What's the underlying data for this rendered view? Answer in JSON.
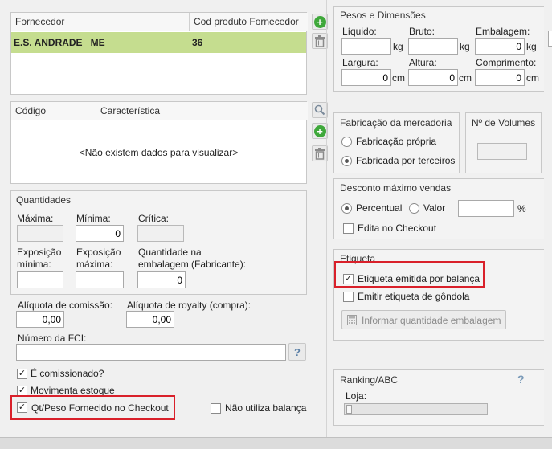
{
  "supplier_table": {
    "columns": [
      "Fornecedor",
      "Cod produto Fornecedor"
    ],
    "rows": [
      {
        "supplier": "E.S. ANDRADE   ME",
        "code": "36"
      }
    ]
  },
  "char_table": {
    "columns": [
      "Código",
      "Característica"
    ],
    "empty_message": "<Não existem dados para visualizar>"
  },
  "quantities": {
    "title": "Quantidades",
    "max_label": "Máxima:",
    "min_label": "Mínima:",
    "min_value": "0",
    "critical_label": "Crítica:",
    "exp_min_label": "Exposição mínima:",
    "exp_max_label": "Exposição máxima:",
    "pack_qty_label": "Quantidade na embalagem (Fabricante):",
    "pack_qty_value": "0"
  },
  "commission": {
    "label": "Alíquota de comissão:",
    "value": "0,00",
    "royalty_label": "Alíquota de royalty (compra):",
    "royalty_value": "0,00",
    "fci_label": "Número da FCI:",
    "help": "?"
  },
  "checkboxes": {
    "commissioned": "É comissionado?",
    "stock_movement": "Movimenta estoque",
    "checkout_qty": "Qt/Peso Fornecido no Checkout",
    "no_scale": "Não utiliza balança"
  },
  "weights": {
    "title": "Pesos e Dimensões",
    "liquid_label": "Líquido:",
    "gross_label": "Bruto:",
    "package_label": "Embalagem:",
    "package_value": "0",
    "kg": "kg",
    "width_label": "Largura:",
    "width_value": "0",
    "height_label": "Altura:",
    "height_value": "0",
    "length_label": "Comprimento:",
    "length_value": "0",
    "cm": "cm"
  },
  "manufacturing": {
    "title": "Fabricação da mercadoria",
    "own": "Fabricação própria",
    "third": "Fabricada por terceiros"
  },
  "volumes": {
    "title": "Nº de Volumes"
  },
  "discount": {
    "title": "Desconto máximo vendas",
    "percent": "Percentual",
    "value": "Valor",
    "unit": "%",
    "edit_checkout": "Edita no Checkout"
  },
  "label_group": {
    "title": "Etiqueta",
    "scale_label": "Etiqueta emitida por balança",
    "shelf_label": "Emitir etiqueta de gôndola",
    "inform_button": "Informar quantidade embalagem"
  },
  "ranking": {
    "title": "Ranking/ABC",
    "help": "?",
    "store_label": "Loja:"
  },
  "colors": {
    "selected_row": "#c5dd8f",
    "highlight": "#d9202a",
    "add_icon": "#3ea83a"
  }
}
